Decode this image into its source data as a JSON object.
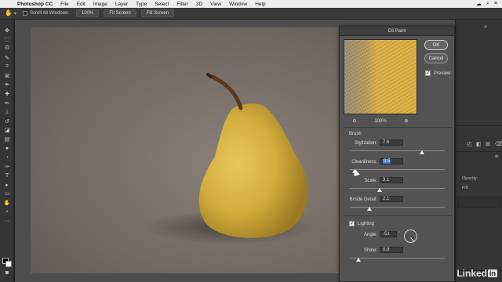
{
  "menubar": {
    "app_name": "Photoshop CC",
    "items": [
      "File",
      "Edit",
      "Image",
      "Layer",
      "Type",
      "Select",
      "Filter",
      "3D",
      "View",
      "Window",
      "Help"
    ]
  },
  "options_bar": {
    "scroll_all_label": "Scroll All Windows",
    "zoom_button": "100%",
    "fit_screen_button": "Fit Screen",
    "fill_screen_button": "Fill Screen"
  },
  "dialog": {
    "title": "Oil Paint",
    "ok_label": "OK",
    "cancel_label": "Cancel",
    "preview_label": "Preview",
    "preview_checked": true,
    "zoom_level": "100%",
    "brush_section": "Brush",
    "params": {
      "stylization": {
        "label": "Stylization:",
        "value": "7.6",
        "slider": 0.76
      },
      "cleanliness": {
        "label": "Cleanliness:",
        "value": "0.5",
        "slider": 0.05
      },
      "scale": {
        "label": "Scale:",
        "value": "3.1",
        "slider": 0.31
      },
      "bristle": {
        "label": "Bristle Detail:",
        "value": "2.1",
        "slider": 0.21
      }
    },
    "lighting_label": "Lighting",
    "lighting_checked": true,
    "angle": {
      "label": "Angle:",
      "value": "-51",
      "degrees": -51
    },
    "shine": {
      "label": "Shine:",
      "value": "0.9",
      "slider": 0.09
    }
  },
  "right_panel": {
    "opacity_label": "Opacity:",
    "fill_label": "Fill:"
  },
  "watermark": {
    "text": "Linked",
    "badge": "in"
  },
  "icons": [
    "hand-icon",
    "move-icon",
    "marquee-icon",
    "lasso-icon",
    "crop-icon",
    "brush-icon",
    "zoom-in-icon",
    "zoom-out-icon",
    "angle-dial-icon"
  ]
}
